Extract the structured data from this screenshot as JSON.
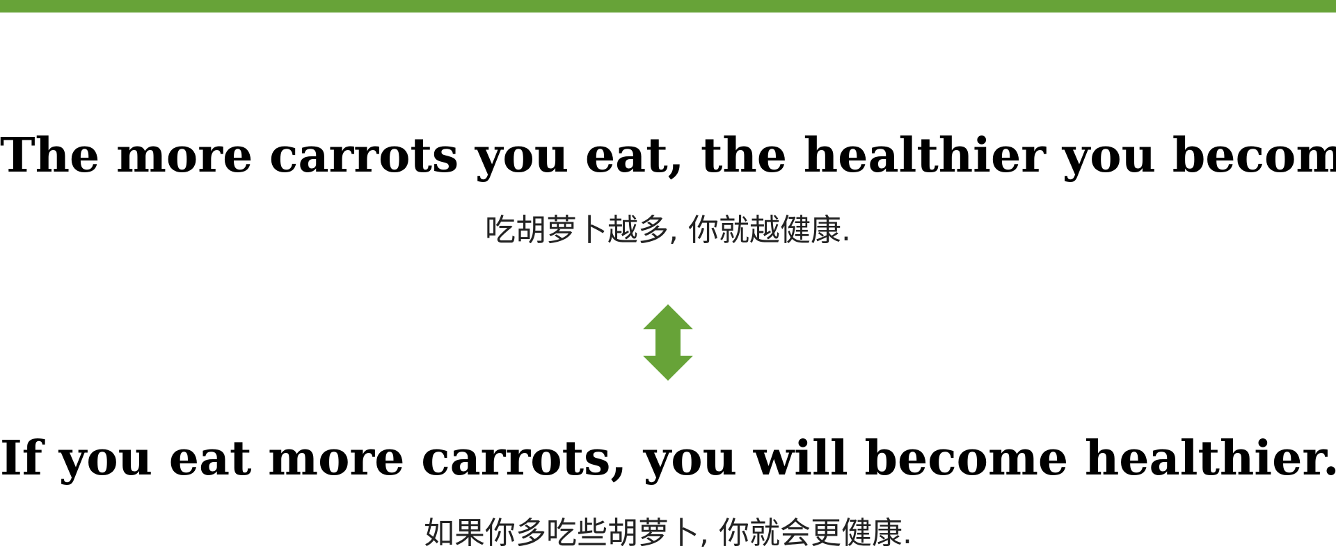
{
  "colors": {
    "accent": "#67a338",
    "text": "#000000",
    "background": "#ffffff"
  },
  "sentence_1": {
    "english": "The more carrots you eat, the healthier you become.",
    "chinese": "吃胡萝卜越多, 你就越健康."
  },
  "connector": {
    "icon": "double-headed-vertical-arrow-icon"
  },
  "sentence_2": {
    "english": "If you eat more carrots, you will become healthier.",
    "chinese": "如果你多吃些胡萝卜, 你就会更健康."
  }
}
